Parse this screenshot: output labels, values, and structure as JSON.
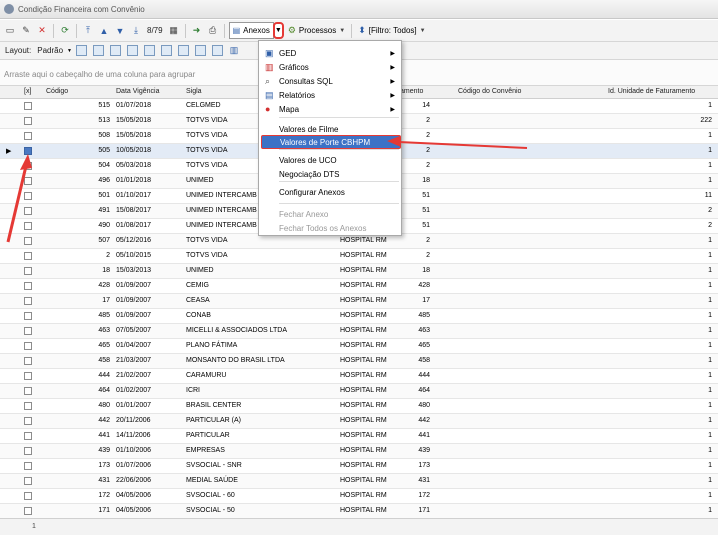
{
  "window": {
    "title": "Condição Financeira com Convênio"
  },
  "toolbar": {
    "page_info": "8/79",
    "anexos_label": "Anexos",
    "processos_label": "Processos",
    "filtro_label": "[Filtro: Todos]",
    "layout_label": "Layout:",
    "padrao_label": "Padrão"
  },
  "grid": {
    "group_hint": "Arraste aqui o cabeçalho de uma coluna para agrupar",
    "headers": {
      "x": "[x]",
      "codigo": "Código",
      "data": "Data Vigência",
      "sigla": "Sigla",
      "plano": "amento",
      "codconv": "Código do Convênio",
      "idunid": "Id. Unidade de Faturamento"
    },
    "rows": [
      {
        "codigo": "515",
        "data": "01/07/2018",
        "sigla": "CELGMED",
        "plano": "",
        "codconv": "14",
        "idunid": "1"
      },
      {
        "codigo": "513",
        "data": "15/05/2018",
        "sigla": "TOTVS VIDA",
        "plano": "",
        "codconv": "2",
        "idunid": "222"
      },
      {
        "codigo": "508",
        "data": "15/05/2018",
        "sigla": "TOTVS VIDA",
        "plano": "",
        "codconv": "2",
        "idunid": "1"
      },
      {
        "codigo": "505",
        "data": "10/05/2018",
        "sigla": "TOTVS VIDA",
        "plano": "",
        "codconv": "2",
        "idunid": "1"
      },
      {
        "codigo": "504",
        "data": "05/03/2018",
        "sigla": "TOTVS VIDA",
        "plano": "",
        "codconv": "2",
        "idunid": "1"
      },
      {
        "codigo": "496",
        "data": "01/01/2018",
        "sigla": "UNIMED",
        "plano": "",
        "codconv": "18",
        "idunid": "1"
      },
      {
        "codigo": "501",
        "data": "01/10/2017",
        "sigla": "UNIMED INTERCAMB",
        "plano": "",
        "codconv": "51",
        "idunid": "11"
      },
      {
        "codigo": "491",
        "data": "15/08/2017",
        "sigla": "UNIMED INTERCAMB",
        "plano": "ssistência M...",
        "codconv": "51",
        "idunid": "2"
      },
      {
        "codigo": "490",
        "data": "01/08/2017",
        "sigla": "UNIMED INTERCAMB",
        "plano": "ssistência M...",
        "codconv": "51",
        "idunid": "2"
      },
      {
        "codigo": "507",
        "data": "05/12/2016",
        "sigla": "TOTVS VIDA",
        "plano": "HOSPITAL RM",
        "codconv": "2",
        "idunid": "1"
      },
      {
        "codigo": "2",
        "data": "05/10/2015",
        "sigla": "TOTVS VIDA",
        "plano": "HOSPITAL RM",
        "codconv": "2",
        "idunid": "1"
      },
      {
        "codigo": "18",
        "data": "15/03/2013",
        "sigla": "UNIMED",
        "plano": "HOSPITAL RM",
        "codconv": "18",
        "idunid": "1"
      },
      {
        "codigo": "428",
        "data": "01/09/2007",
        "sigla": "CEMIG",
        "plano": "HOSPITAL RM",
        "codconv": "428",
        "idunid": "1"
      },
      {
        "codigo": "17",
        "data": "01/09/2007",
        "sigla": "CEASA",
        "plano": "HOSPITAL RM",
        "codconv": "17",
        "idunid": "1"
      },
      {
        "codigo": "485",
        "data": "01/09/2007",
        "sigla": "CONAB",
        "plano": "HOSPITAL RM",
        "codconv": "485",
        "idunid": "1"
      },
      {
        "codigo": "463",
        "data": "07/05/2007",
        "sigla": "MICELLI & ASSOCIADOS LTDA",
        "plano": "HOSPITAL RM",
        "codconv": "463",
        "idunid": "1"
      },
      {
        "codigo": "465",
        "data": "01/04/2007",
        "sigla": "PLANO FÁTIMA",
        "plano": "HOSPITAL RM",
        "codconv": "465",
        "idunid": "1"
      },
      {
        "codigo": "458",
        "data": "21/03/2007",
        "sigla": "MONSANTO DO BRASIL LTDA",
        "plano": "HOSPITAL RM",
        "codconv": "458",
        "idunid": "1"
      },
      {
        "codigo": "444",
        "data": "21/02/2007",
        "sigla": "CARAMURU",
        "plano": "HOSPITAL RM",
        "codconv": "444",
        "idunid": "1"
      },
      {
        "codigo": "464",
        "data": "01/02/2007",
        "sigla": "ICRI",
        "plano": "HOSPITAL RM",
        "codconv": "464",
        "idunid": "1"
      },
      {
        "codigo": "480",
        "data": "01/01/2007",
        "sigla": "BRASIL CENTER",
        "plano": "HOSPITAL RM",
        "codconv": "480",
        "idunid": "1"
      },
      {
        "codigo": "442",
        "data": "20/11/2006",
        "sigla": "PARTICULAR (A)",
        "plano": "HOSPITAL RM",
        "codconv": "442",
        "idunid": "1"
      },
      {
        "codigo": "441",
        "data": "14/11/2006",
        "sigla": "PARTICULAR",
        "plano": "HOSPITAL RM",
        "codconv": "441",
        "idunid": "1"
      },
      {
        "codigo": "439",
        "data": "01/10/2006",
        "sigla": "EMPRESAS",
        "plano": "HOSPITAL RM",
        "codconv": "439",
        "idunid": "1"
      },
      {
        "codigo": "173",
        "data": "01/07/2006",
        "sigla": "SVSOCIAL - SNR",
        "plano": "HOSPITAL RM",
        "codconv": "173",
        "idunid": "1"
      },
      {
        "codigo": "431",
        "data": "22/06/2006",
        "sigla": "MEDIAL SAÚDE",
        "plano": "HOSPITAL RM",
        "codconv": "431",
        "idunid": "1"
      },
      {
        "codigo": "172",
        "data": "04/05/2006",
        "sigla": "SVSOCIAL - 60",
        "plano": "HOSPITAL RM",
        "codconv": "172",
        "idunid": "1"
      },
      {
        "codigo": "171",
        "data": "04/05/2006",
        "sigla": "SVSOCIAL - 50",
        "plano": "HOSPITAL RM",
        "codconv": "171",
        "idunid": "1"
      }
    ],
    "footer_count": "1"
  },
  "menu": {
    "items": [
      {
        "label": "GED",
        "icon": "ged-icon",
        "sub": true,
        "disabled": false
      },
      {
        "label": "Gráficos",
        "icon": "chart-icon",
        "sub": true,
        "disabled": false
      },
      {
        "label": "Consultas SQL",
        "icon": "sql-icon",
        "sub": true,
        "disabled": false
      },
      {
        "label": "Relatórios",
        "icon": "report-icon",
        "sub": true,
        "disabled": false
      },
      {
        "label": "Mapa",
        "icon": "map-pin-icon",
        "sub": true,
        "disabled": false
      },
      {
        "label": "Valores de Filme",
        "icon": "",
        "sub": false,
        "disabled": false
      },
      {
        "label": "Valores de Porte CBHPM",
        "icon": "",
        "sub": false,
        "disabled": false,
        "highlight": true
      },
      {
        "label": "Valores de UCO",
        "icon": "",
        "sub": false,
        "disabled": false
      },
      {
        "label": "Negociação DTS",
        "icon": "",
        "sub": false,
        "disabled": false
      },
      {
        "label": "Configurar Anexos",
        "icon": "",
        "sub": false,
        "disabled": false
      },
      {
        "label": "Fechar Anexo",
        "icon": "",
        "sub": false,
        "disabled": true
      },
      {
        "label": "Fechar Todos os Anexos",
        "icon": "",
        "sub": false,
        "disabled": true
      }
    ]
  },
  "colors": {
    "accent": "#3d72c6",
    "annotation": "#e53935"
  }
}
